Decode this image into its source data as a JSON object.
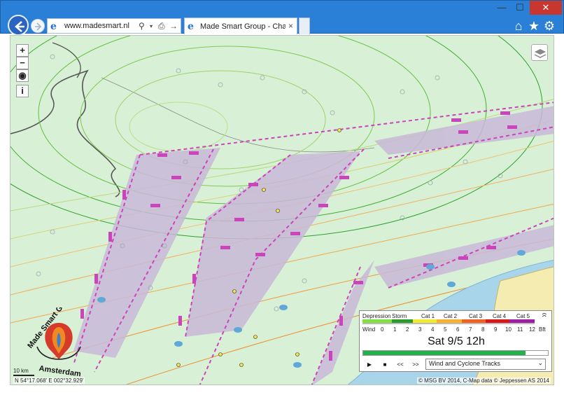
{
  "browser": {
    "url": "www.madesmart.nl",
    "tab_title": "Made Smart Group - ChartS...",
    "window_controls": {
      "minimize": "—",
      "maximize": "☐",
      "close": "✕"
    },
    "tab_close": "×"
  },
  "map": {
    "zoom_in": "+",
    "zoom_out": "−",
    "info": "i",
    "scale_label": "10 km",
    "coordinates": "N 54°17.068'  E 002°32.929'",
    "copyright": "© MSG BV 2014, C-Map data © Jeppessen AS 2014",
    "logo_top": "Made Smart Group",
    "logo_bottom": "Amsterdam",
    "colors": {
      "sea": "#d8f0d6",
      "track": "#cc44bb",
      "wind_green": "#22aa33",
      "wind_orange": "#f0a040"
    }
  },
  "legend": {
    "categories": [
      "Depression",
      "Storm",
      "Cat 1",
      "Cat 2",
      "Cat 3",
      "Cat 4",
      "Cat 5"
    ],
    "wind_label": "Wind",
    "wind_scale": [
      "0",
      "1",
      "2",
      "3",
      "4",
      "5",
      "6",
      "7",
      "8",
      "9",
      "10",
      "11",
      "12",
      "Bft"
    ],
    "timestamp": "Sat 9/5 12h",
    "progress": 0.88,
    "buttons": {
      "play": "▶",
      "stop": "■",
      "rewind": "<<",
      "forward": ">>"
    },
    "layer_select": "Wind and Cyclone Tracks"
  }
}
